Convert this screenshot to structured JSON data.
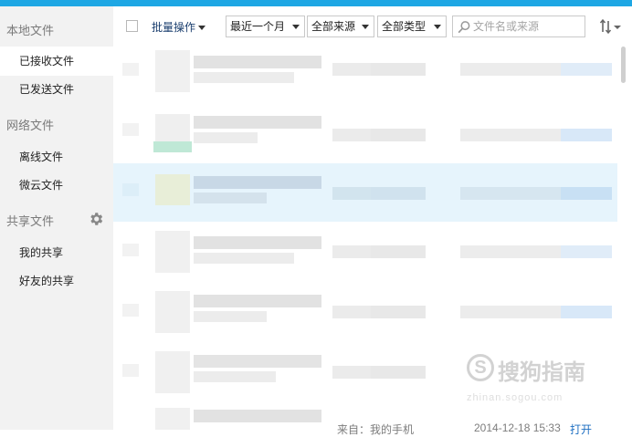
{
  "colors": {
    "accent": "#1ea7e4",
    "sidebar_bg": "#f2f2f2",
    "selected_row": "#e6f4fc",
    "link": "#1a3e6e"
  },
  "sidebar": {
    "sections": [
      {
        "title": "本地文件",
        "items": [
          "已接收文件",
          "已发送文件"
        ]
      },
      {
        "title": "网络文件",
        "items": [
          "离线文件",
          "微云文件"
        ]
      },
      {
        "title": "共享文件",
        "items": [
          "我的共享",
          "好友的共享"
        ],
        "has_settings_icon": true
      }
    ],
    "active_item": "已接收文件"
  },
  "toolbar": {
    "batch_label": "批量操作",
    "time_filter": "最近一个月",
    "source_filter": "全部来源",
    "type_filter": "全部类型",
    "search_placeholder": "文件名或来源",
    "sort_icon": "sort-icon"
  },
  "file_list": {
    "rows_visible": 7,
    "selected_row_index": 2,
    "content_obscured": true,
    "partial_bottom_text": {
      "source": "来自：我的手机",
      "time": "2014-12-18 15:33",
      "action": "打开"
    }
  },
  "watermark": {
    "brand": "搜狗指南",
    "url": "zhinan.sogou.com",
    "logo_glyph": "S"
  }
}
